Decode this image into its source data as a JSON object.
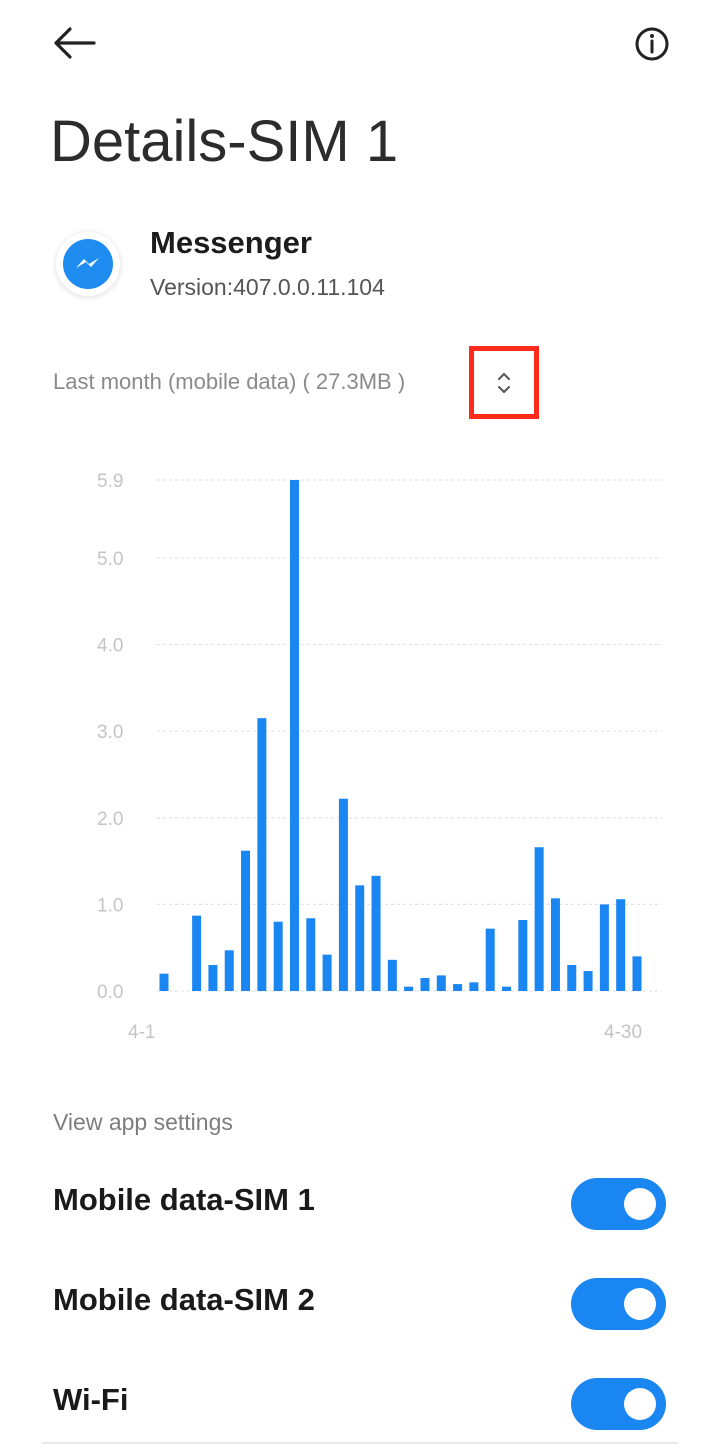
{
  "header": {
    "back_icon": "arrow-left-icon",
    "info_icon": "info-icon",
    "title": "Details-SIM 1"
  },
  "app": {
    "icon": "messenger-icon",
    "name": "Messenger",
    "version": "Version:407.0.0.11.104"
  },
  "usage": {
    "period_label": "Last month (mobile data) ( 27.3MB )",
    "toggle_icon": "chevron-up-down-icon"
  },
  "colors": {
    "accent": "#1a86f2",
    "highlight_box": "#ff2a1a"
  },
  "chart_data": {
    "type": "bar",
    "x_start_label": "4-1",
    "x_end_label": "4-30",
    "y_ticks": [
      "0.0",
      "1.0",
      "2.0",
      "3.0",
      "4.0",
      "5.0",
      "5.9"
    ],
    "ylim": [
      0,
      5.9
    ],
    "grid": true,
    "values": [
      0.2,
      0,
      0.87,
      0.3,
      0.47,
      1.62,
      3.15,
      0.8,
      5.9,
      0.84,
      0.42,
      2.22,
      1.22,
      1.33,
      0.36,
      0.05,
      0.15,
      0.18,
      0.08,
      0.1,
      0.72,
      0.05,
      0.82,
      1.66,
      1.07,
      0.3,
      0.23,
      1.0,
      1.06,
      0.4
    ]
  },
  "settings": {
    "header": "View app settings",
    "rows": [
      {
        "label": "Mobile data-SIM 1",
        "enabled": true
      },
      {
        "label": "Mobile data-SIM 2",
        "enabled": true
      },
      {
        "label": "Wi-Fi",
        "enabled": true
      }
    ]
  }
}
